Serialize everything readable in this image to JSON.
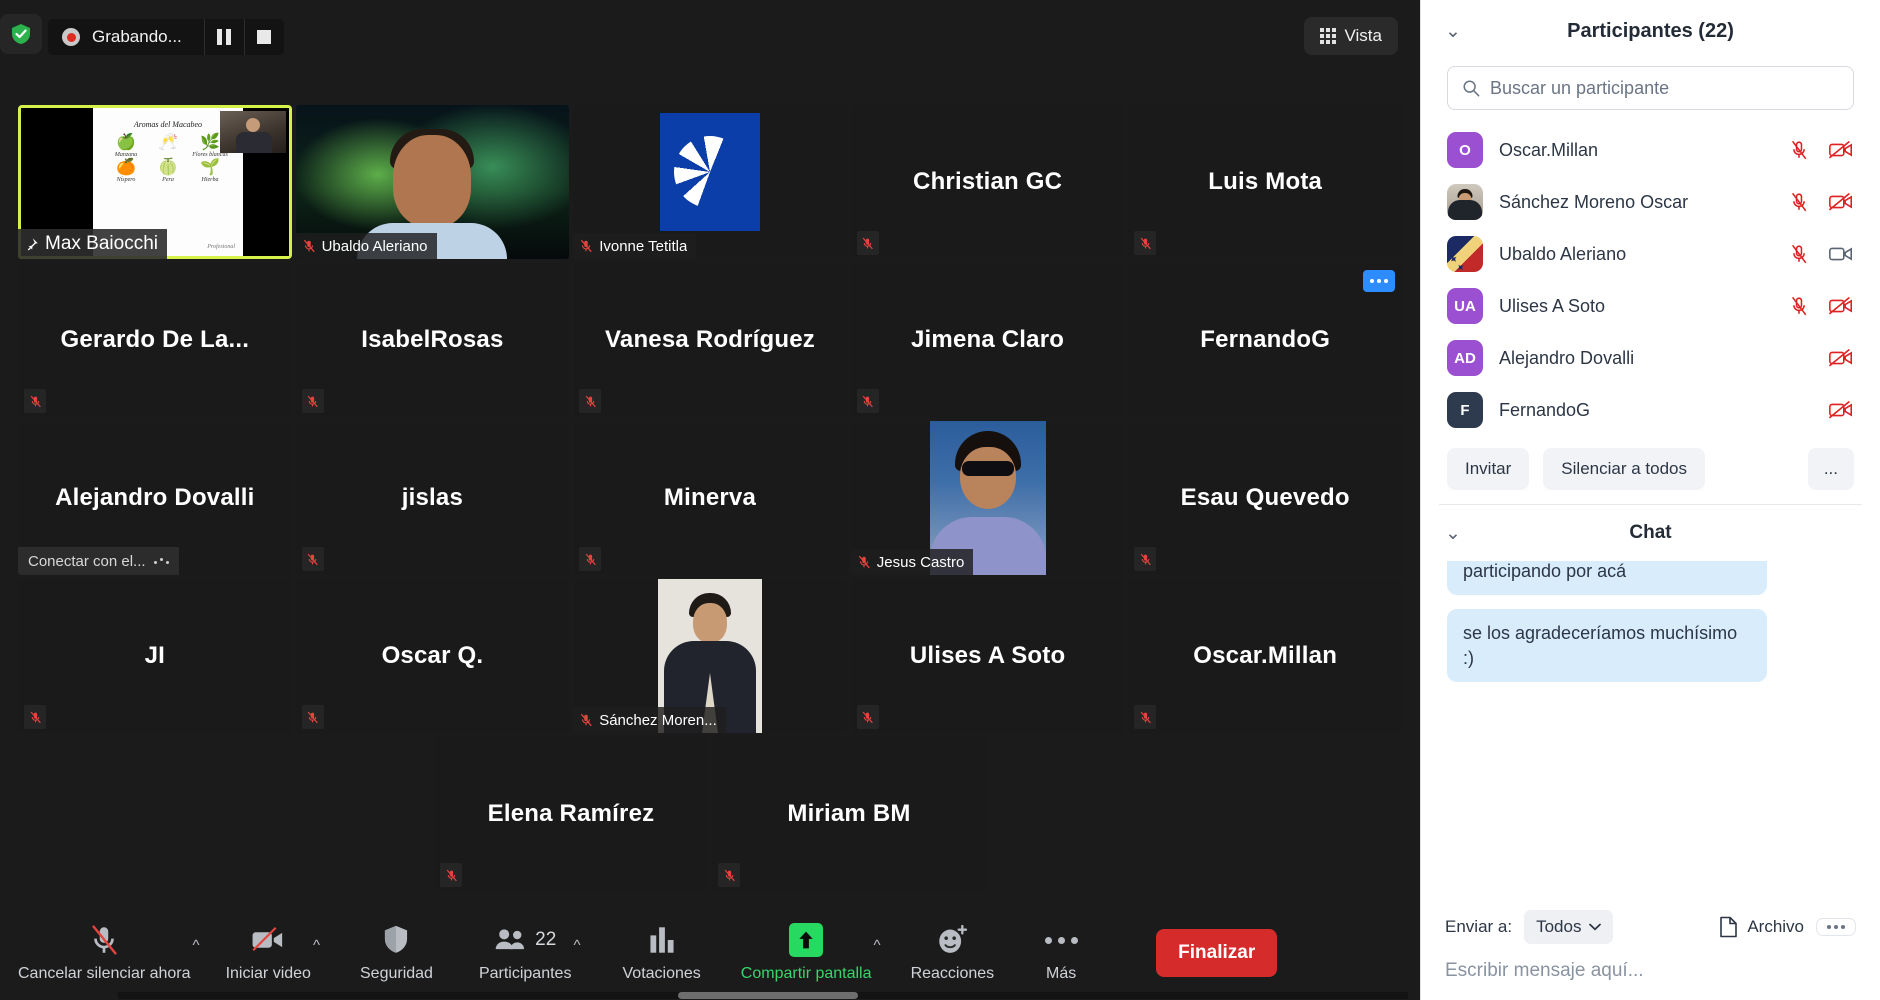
{
  "recording": {
    "status_label": "Grabando...",
    "pause_title": "Pausar grabación",
    "stop_title": "Detener grabación"
  },
  "topbar": {
    "view_label": "Vista"
  },
  "grid": {
    "rows": [
      [
        {
          "name": "Max Baiocchi",
          "kind": "share",
          "active": true,
          "pinned": true,
          "muted": true
        },
        {
          "name": "Ubaldo Aleriano",
          "kind": "video-aurora",
          "muted": true
        },
        {
          "name": "Ivonne Tetitla",
          "kind": "video-logo",
          "muted": true
        },
        {
          "name": "Christian GC",
          "kind": "avatar",
          "muted": true
        },
        {
          "name": "Luis Mota",
          "kind": "avatar",
          "muted": true
        }
      ],
      [
        {
          "name": "Gerardo  De  La...",
          "kind": "avatar",
          "muted": true
        },
        {
          "name": "IsabelRosas",
          "kind": "avatar",
          "muted": true
        },
        {
          "name": "Vanesa Rodríguez",
          "kind": "avatar",
          "muted": true
        },
        {
          "name": "Jimena Claro",
          "kind": "avatar",
          "muted": true
        },
        {
          "name": "FernandoG",
          "kind": "avatar",
          "muted": false,
          "more": true
        }
      ],
      [
        {
          "name": "Alejandro Dovalli",
          "kind": "avatar",
          "muted": false,
          "tooltip": "Conectar con el..."
        },
        {
          "name": "jislas",
          "kind": "avatar",
          "muted": true
        },
        {
          "name": "Minerva",
          "kind": "avatar",
          "muted": true
        },
        {
          "name": "Jesus Castro",
          "kind": "video-jc",
          "muted": true
        },
        {
          "name": "Esau Quevedo",
          "kind": "avatar",
          "muted": true
        }
      ],
      [
        {
          "name": "JI",
          "kind": "avatar",
          "muted": true
        },
        {
          "name": "Oscar Q.",
          "kind": "avatar",
          "muted": true
        },
        {
          "name": "Sánchez Moren...",
          "kind": "video-sm",
          "muted": true
        },
        {
          "name": "Ulises A Soto",
          "kind": "avatar",
          "muted": true
        },
        {
          "name": "Oscar.Millan",
          "kind": "avatar",
          "muted": true
        }
      ],
      [
        {
          "name": "Elena Ramírez",
          "kind": "avatar",
          "muted": true
        },
        {
          "name": "Miriam BM",
          "kind": "avatar",
          "muted": true
        }
      ]
    ]
  },
  "slide": {
    "title": "Aromas del Macabeo",
    "items": [
      {
        "glyph": "🍏",
        "caption": "Manzana"
      },
      {
        "glyph": "🥂",
        "caption": ""
      },
      {
        "glyph": "🌿",
        "caption": "Flores blancas"
      },
      {
        "glyph": "🍊",
        "caption": "Níspero"
      },
      {
        "glyph": "🍈",
        "caption": "Pera"
      },
      {
        "glyph": "🌱",
        "caption": "Hierba"
      }
    ],
    "signature": "Profesional"
  },
  "toolbar": {
    "mute": {
      "label": "Cancelar silenciar ahora",
      "icon": "mic-off-icon"
    },
    "video": {
      "label": "Iniciar video",
      "icon": "video-off-icon"
    },
    "security": {
      "label": "Seguridad",
      "icon": "shield-icon"
    },
    "participants": {
      "label": "Participantes",
      "icon": "people-icon",
      "count": "22"
    },
    "polls": {
      "label": "Votaciones",
      "icon": "bar-chart-icon"
    },
    "share": {
      "label": "Compartir pantalla",
      "icon": "share-screen-icon"
    },
    "reactions": {
      "label": "Reacciones",
      "icon": "smiley-plus-icon"
    },
    "more": {
      "label": "Más",
      "icon": "ellipsis-icon"
    },
    "end": {
      "label": "Finalizar"
    }
  },
  "participants_panel": {
    "title": "Participantes (22)",
    "search_placeholder": "Buscar un participante",
    "list": [
      {
        "name": "Oscar.Millan",
        "initials": "O",
        "avatar_type": "initials",
        "avatar_color": "#9b4fd1",
        "mic": "muted",
        "cam": "off"
      },
      {
        "name": "Sánchez Moreno Oscar",
        "initials": "",
        "avatar_type": "photo",
        "avatar_color": "#a79d91",
        "mic": "muted",
        "cam": "off"
      },
      {
        "name": "Ubaldo Aleriano",
        "initials": "",
        "avatar_type": "flag",
        "avatar_color": "#1b2a63",
        "mic": "muted",
        "cam": "on"
      },
      {
        "name": "Ulises A Soto",
        "initials": "UA",
        "avatar_type": "initials",
        "avatar_color": "#9b4fd1",
        "mic": "muted",
        "cam": "off"
      },
      {
        "name": "Alejandro Dovalli",
        "initials": "AD",
        "avatar_type": "initials",
        "avatar_color": "#9b4fd1",
        "mic": "none",
        "cam": "off"
      },
      {
        "name": "FernandoG",
        "initials": "F",
        "avatar_type": "initials",
        "avatar_color": "#2e3a4d",
        "mic": "none",
        "cam": "off"
      }
    ],
    "actions": {
      "invite": "Invitar",
      "mute_all": "Silenciar a todos",
      "more": "..."
    }
  },
  "chat_panel": {
    "title": "Chat",
    "messages": [
      {
        "text": "participando por acá",
        "clipped": true
      },
      {
        "text": "se los agradeceríamos muchísimo :)",
        "clipped": false
      }
    ],
    "send_to_label": "Enviar a:",
    "send_to_value": "Todos",
    "file_label": "Archivo",
    "input_placeholder": "Escribir mensaje aquí..."
  },
  "colors": {
    "accent_green": "#27d861",
    "end_red": "#d62b2b",
    "mute_red": "#e4443f",
    "active_border": "#d5f24a",
    "panel_bg": "#ffffff",
    "stage_bg": "#1b1b1b",
    "bubble_blue": "#d9ecfb"
  }
}
